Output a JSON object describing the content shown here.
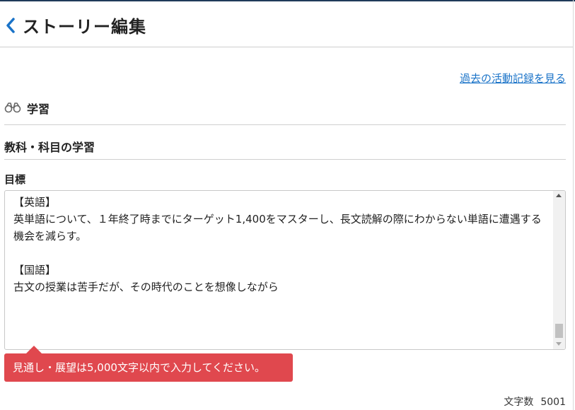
{
  "header": {
    "title": "ストーリー編集",
    "back_icon": "chevron-left-icon"
  },
  "links": {
    "history": "過去の活動記録を見る"
  },
  "section": {
    "icon": "binoculars-icon",
    "label": "学習"
  },
  "subject": {
    "label": "教科・科目の学習"
  },
  "goal": {
    "label": "目標",
    "text": "【英語】\n英単語について、１年終了時までにターゲット1,400をマスターし、長文読解の際にわからない単語に遭遇する機会を減らす。\n\n【国語】\n古文の授業は苦手だが、その時代のことを想像しながら"
  },
  "error": {
    "message": "見通し・展望は5,000文字以内で入力してください。"
  },
  "counter": {
    "label": "文字数",
    "value": "5001"
  },
  "colors": {
    "accent_blue": "#1a73c8",
    "error_red": "#e0484e",
    "top_bar": "#1f3a5a"
  }
}
